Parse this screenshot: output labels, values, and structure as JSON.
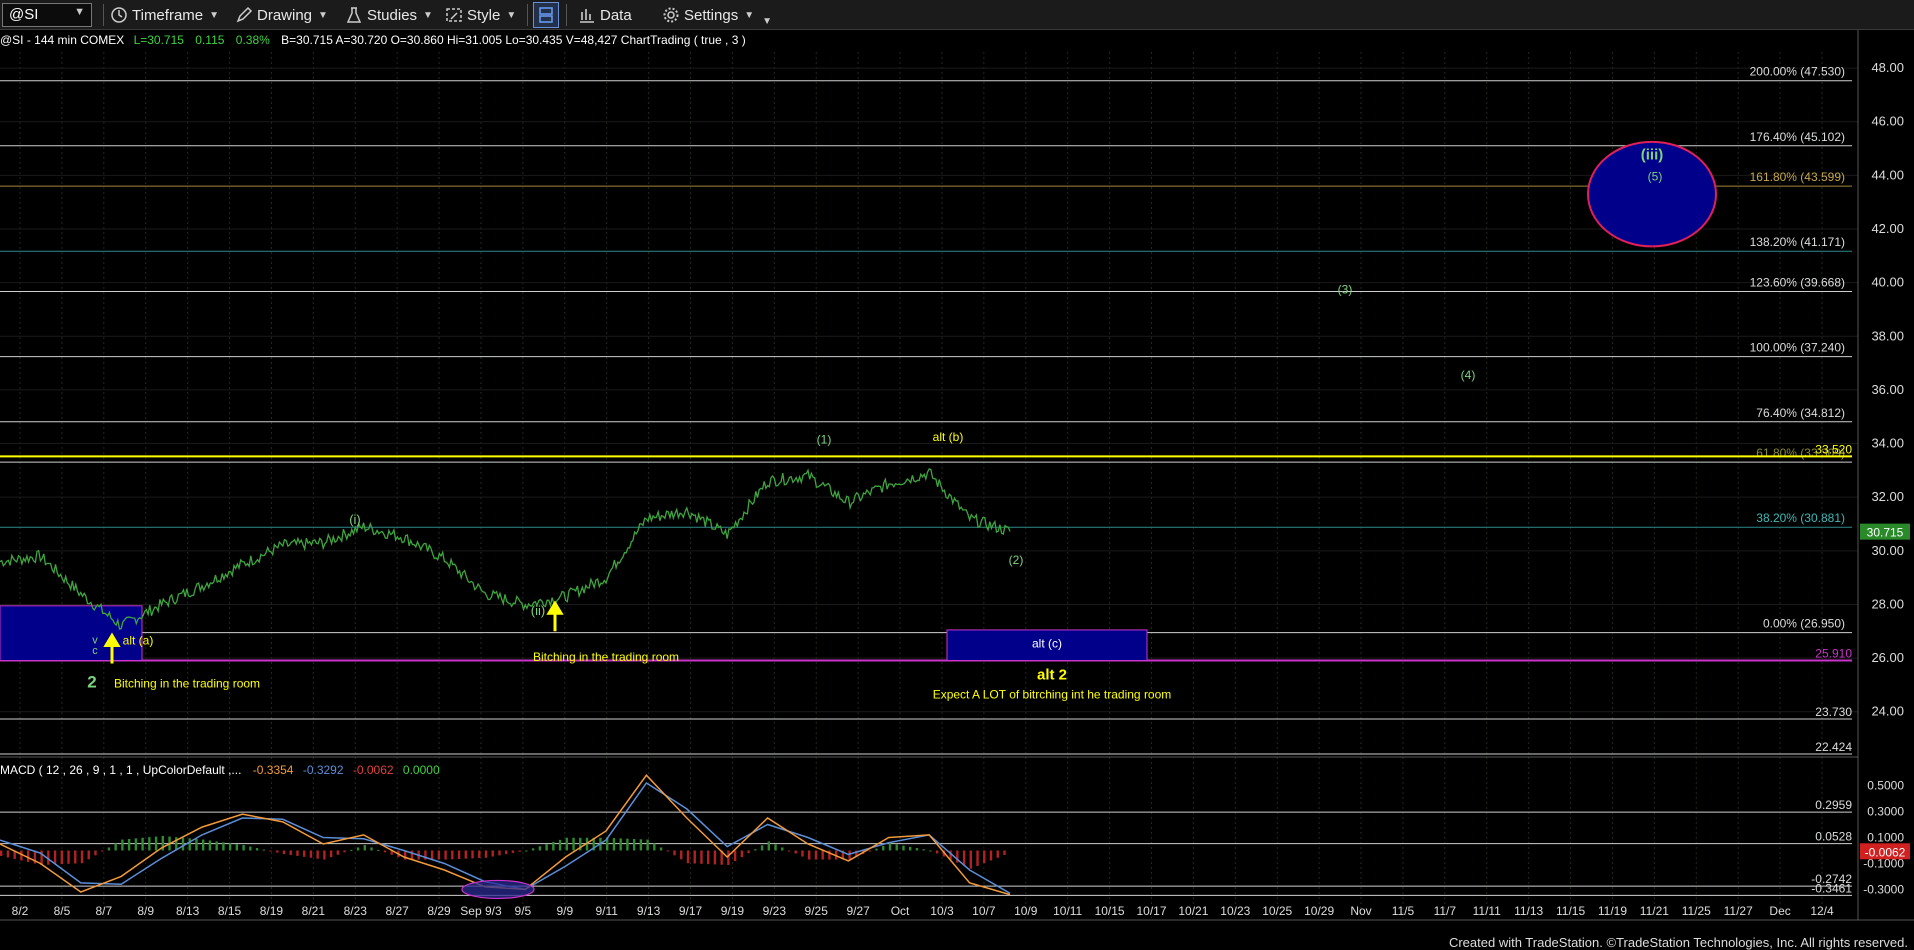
{
  "toolbar": {
    "symbol": "@SI",
    "timeframe": "Timeframe",
    "drawing": "Drawing",
    "studies": "Studies",
    "style": "Style",
    "data": "Data",
    "settings": "Settings"
  },
  "header": {
    "symbol_desc": "@SI - 144 min  COMEX",
    "last": "L=30.715",
    "change": "0.115",
    "pct": "0.38%",
    "rest": "B=30.715  A=30.720  O=30.860  Hi=31.005  Lo=30.435  V=48,427  ChartTrading ( true , 3 )"
  },
  "colors": {
    "background": "#000000",
    "price": "#3fa53f",
    "yellow": "#ffff00",
    "magenta": "#cc33cc",
    "box_fill": "#00008b",
    "green_label": "#7dd37d",
    "macd": "#f39a3c",
    "signal": "#5b8ed8",
    "hist_up": "#2e8b2e",
    "hist_down": "#b22222",
    "last_price_bg": "#2a8a2a"
  },
  "chart_data": [
    {
      "type": "line",
      "title": "",
      "ylim": [
        22.2,
        48.6
      ],
      "y_ticks": [
        "48.00",
        "46.00",
        "44.00",
        "42.00",
        "40.00",
        "38.00",
        "36.00",
        "34.00",
        "32.00",
        "30.00",
        "28.00",
        "26.00",
        "24.00"
      ],
      "x_ticks": [
        "8/2",
        "8/5",
        "8/7",
        "8/9",
        "8/13",
        "8/15",
        "8/19",
        "8/21",
        "8/23",
        "8/27",
        "8/29",
        "Sep 9/3",
        "9/5",
        "9/9",
        "9/11",
        "9/13",
        "9/17",
        "9/19",
        "9/23",
        "9/25",
        "9/27",
        "Oct",
        "10/3",
        "10/7",
        "10/9",
        "10/11",
        "10/15",
        "10/17",
        "10/21",
        "10/23",
        "10/25",
        "10/29",
        "Nov",
        "11/5",
        "11/7",
        "11/11",
        "11/13",
        "11/15",
        "11/19",
        "11/21",
        "11/25",
        "11/27",
        "Dec",
        "12/4"
      ],
      "series": [
        {
          "type": "line",
          "x": [
            0,
            2,
            4,
            6,
            8,
            10,
            12,
            14,
            16,
            18,
            20,
            22,
            24,
            26,
            28,
            30,
            32,
            34,
            36,
            38,
            40,
            42,
            44,
            46,
            48,
            50
          ],
          "values": [
            29.6,
            29.8,
            28.4,
            27.2,
            28.0,
            28.7,
            29.5,
            30.2,
            30.3,
            30.9,
            30.5,
            29.7,
            28.4,
            28.0,
            28.3,
            29.0,
            31.2,
            31.5,
            30.6,
            32.6,
            32.8,
            31.8,
            32.5,
            32.9,
            31.2,
            30.72
          ]
        }
      ],
      "last_price": "30.715",
      "fib_levels": [
        {
          "label": "200.00% (47.530)",
          "value": 47.53
        },
        {
          "label": "176.40% (45.102)",
          "value": 45.102
        },
        {
          "label": "161.80% (43.599)",
          "value": 43.599
        },
        {
          "label": "138.20% (41.171)",
          "value": 41.171
        },
        {
          "label": "123.60% (39.668)",
          "value": 39.668
        },
        {
          "label": "100.00% (37.240)",
          "value": 37.24
        },
        {
          "label": "76.40% (34.812)",
          "value": 34.812
        },
        {
          "label": "61.80% (33.309)",
          "value": 33.309
        },
        {
          "label": "38.20% (30.881)",
          "value": 30.881
        },
        {
          "label": "0.00% (26.950)",
          "value": 26.95
        }
      ],
      "horizontal_lines": [
        {
          "label": "33.520",
          "value": 33.52,
          "color": "yellow"
        },
        {
          "label": "25.910",
          "value": 25.91,
          "color": "magenta"
        },
        {
          "label": "23.730",
          "value": 23.73,
          "color": "grey"
        },
        {
          "label": "22.424",
          "value": 22.424,
          "color": "grey"
        }
      ],
      "annotations": [
        "(iii)",
        "(5)",
        "(3)",
        "(4)",
        "(1)",
        "alt (b)",
        "(i)",
        "(2)",
        "(ii)",
        "alt (a)",
        "v",
        "c",
        "2",
        "Bitching in the trading room",
        "Bitching in the trading room",
        "alt (c)",
        "alt 2",
        "Expect A LOT of bitrching int he trading room"
      ]
    },
    {
      "type": "line",
      "title": "MACD ( 12 , 26 , 9 , 1 , 1 , UpColorDefault ,...",
      "legend_values": [
        "-0.3354",
        "-0.3292",
        "-0.0062",
        "0.0000"
      ],
      "ylim": [
        -0.42,
        0.62
      ],
      "y_ticks": [
        "0.5000",
        "0.3000",
        "0.1000",
        "-0.1000",
        "-0.3000"
      ],
      "levels": [
        {
          "label": "0.2959",
          "value": 0.2959
        },
        {
          "label": "0.0528",
          "value": 0.0528
        },
        {
          "label": "-0.2742",
          "value": -0.2742
        },
        {
          "label": "-0.3461",
          "value": -0.3461
        }
      ],
      "current_value": "-0.0062",
      "series": [
        {
          "name": "MACD",
          "x": [
            0,
            2,
            4,
            6,
            8,
            10,
            12,
            14,
            16,
            18,
            20,
            22,
            24,
            26,
            28,
            30,
            32,
            34,
            36,
            38,
            40,
            42,
            44,
            46,
            48,
            50
          ],
          "values": [
            0.05,
            -0.1,
            -0.32,
            -0.2,
            0.02,
            0.18,
            0.28,
            0.22,
            0.05,
            0.12,
            -0.05,
            -0.15,
            -0.28,
            -0.3,
            -0.05,
            0.15,
            0.58,
            0.25,
            -0.05,
            0.25,
            0.05,
            -0.08,
            0.1,
            0.12,
            -0.25,
            -0.34
          ]
        },
        {
          "name": "Signal",
          "x": [
            0,
            2,
            4,
            6,
            8,
            10,
            12,
            14,
            16,
            18,
            20,
            22,
            24,
            26,
            28,
            30,
            32,
            34,
            36,
            38,
            40,
            42,
            44,
            46,
            48,
            50
          ],
          "values": [
            0.08,
            -0.02,
            -0.25,
            -0.26,
            -0.06,
            0.12,
            0.25,
            0.24,
            0.1,
            0.09,
            0.0,
            -0.1,
            -0.24,
            -0.3,
            -0.12,
            0.08,
            0.52,
            0.32,
            0.03,
            0.2,
            0.1,
            -0.03,
            0.06,
            0.12,
            -0.15,
            -0.33
          ]
        }
      ]
    }
  ],
  "footer": "Created with TradeStation. ©TradeStation Technologies, Inc. All rights reserved."
}
